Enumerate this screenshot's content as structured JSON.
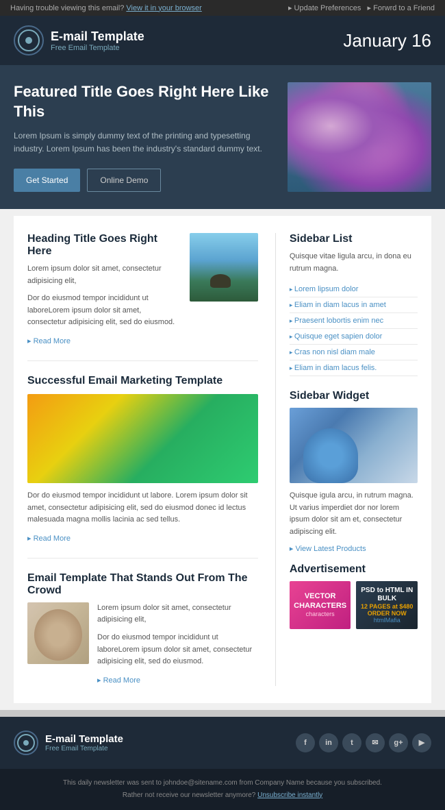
{
  "topbar": {
    "trouble_text": "Having trouble viewing this email?",
    "view_link": "View it in your browser",
    "update_link": "Update Preferences",
    "forward_link": "Forwrd to a Friend"
  },
  "header": {
    "logo_name": "E-mail Template",
    "logo_sub": "Free Email Template",
    "date": "January 16"
  },
  "hero": {
    "title": "Featured Title Goes Right Here Like This",
    "text": "Lorem Ipsum is simply dummy text of the printing and typesetting industry. Lorem Ipsum has been the industry's standard dummy text.",
    "btn_primary": "Get Started",
    "btn_secondary": "Online Demo"
  },
  "article1": {
    "title": "Heading Title Goes Right Here",
    "para1": "Lorem ipsum dolor sit amet, consectetur adipisicing elit,",
    "para2": "Dor do eiusmod tempor incididunt ut laboreLorem ipsum dolor sit amet, consectetur adipisicing elit, sed do eiusmod.",
    "read_more": "Read More"
  },
  "article2": {
    "title": "Successful Email Marketing Template",
    "text": "Dor do eiusmod tempor incididunt ut labore. Lorem ipsum dolor sit amet, consectetur adipisicing elit, sed do eiusmod donec id lectus malesuada magna mollis lacinia ac sed tellus.",
    "read_more": "Read More"
  },
  "article3": {
    "title": "Email Template That Stands Out From The Crowd",
    "para1": "Lorem ipsum dolor sit amet, consectetur adipisicing elit,",
    "para2": "Dor do eiusmod tempor incididunt ut laboreLorem ipsum dolor sit amet, consectetur adipisicing elit, sed do eiusmod.",
    "read_more": "Read More"
  },
  "sidebar": {
    "list_heading": "Sidebar List",
    "list_desc": "Quisque vitae ligula arcu, in dona eu rutrum magna.",
    "list_items": [
      "Lorem lipsum dolor",
      "Eliam in diam lacus in amet",
      "Praesent lobortis enim nec",
      "Quisque eget sapien dolor",
      "Cras non nisl diam male",
      "Eliam in diam lacus felis."
    ],
    "widget_heading": "Sidebar Widget",
    "widget_text": "Quisque igula arcu, in rutrum magna. Ut varius imperdiet dor nor lorem ipsum dolor sit am et, consectetur adipiscing elit.",
    "widget_link": "View Latest Products",
    "ad_heading": "Advertisement",
    "ad1_title": "VECTOR CHARACTERS",
    "ad1_sub": "characters",
    "ad2_title": "PSD to HTML IN BULK",
    "ad2_detail": "12 PAGES at $480",
    "ad2_cta": "ORDER NOW",
    "ad2_brand": "htmlMafia"
  },
  "footer": {
    "logo_name": "E-mail Template",
    "logo_sub": "Free Email Template",
    "social": [
      "f",
      "in",
      "t",
      "✉",
      "g+",
      "▶"
    ],
    "bottom_text": "This daily newsletter was sent to johndoe@sitename.com from Company Name because you subscribed.",
    "bottom_text2": "Rather not receive our newsletter anymore?",
    "unsubscribe": "Unsubscribe instantly"
  }
}
